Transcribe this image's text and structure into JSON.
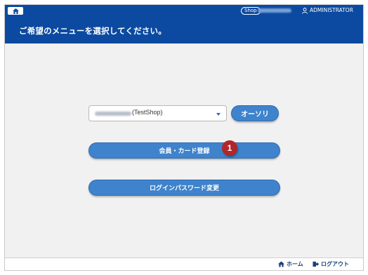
{
  "topbar": {
    "shop_badge": "Shop",
    "user_name": "ADMINISTRATOR"
  },
  "header": {
    "title": "ご希望のメニューを選択してください。"
  },
  "main": {
    "shop_select_value": "(TestShop)",
    "authorize_button": "オーソリ",
    "member_card_button": "会員・カード登録",
    "login_password_button": "ログインパスワード変更",
    "callout_number": "1"
  },
  "footer": {
    "home_label": "ホーム",
    "logout_label": "ログアウト"
  },
  "colors": {
    "header_bg": "#0b4aa0",
    "button_bg": "#3f83cc",
    "callout_bg": "#b1262b"
  },
  "icons": {
    "home": "home-icon",
    "user": "user-icon",
    "logout": "logout-icon",
    "dropdown": "chevron-down-icon"
  }
}
